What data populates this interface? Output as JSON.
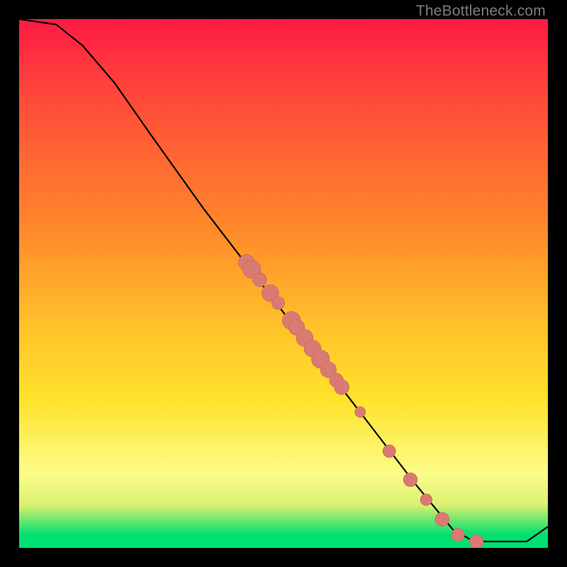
{
  "watermark": "TheBottleneck.com",
  "colors": {
    "red_top": "#ff1a44",
    "orange": "#ff8a2a",
    "yellow": "#ffe22a",
    "pale_yellow": "#fdfd8a",
    "khaki": "#d8f070",
    "green": "#00e070",
    "curve_stroke": "#000000",
    "point_fill": "#d97b72",
    "point_stroke": "#c86a60"
  },
  "chart_data": {
    "type": "line",
    "title": "",
    "xlabel": "",
    "ylabel": "",
    "xlim": [
      0,
      100
    ],
    "ylim": [
      0,
      100
    ],
    "curve": [
      {
        "x": 0,
        "y": 100
      },
      {
        "x": 7,
        "y": 99
      },
      {
        "x": 12,
        "y": 95
      },
      {
        "x": 18,
        "y": 88
      },
      {
        "x": 25,
        "y": 78
      },
      {
        "x": 35,
        "y": 64
      },
      {
        "x": 45,
        "y": 51
      },
      {
        "x": 55,
        "y": 38
      },
      {
        "x": 65,
        "y": 25
      },
      {
        "x": 75,
        "y": 12
      },
      {
        "x": 82,
        "y": 3.5
      },
      {
        "x": 86,
        "y": 1.2
      },
      {
        "x": 92,
        "y": 1.2
      },
      {
        "x": 96,
        "y": 1.2
      },
      {
        "x": 100,
        "y": 4
      }
    ],
    "scatter": [
      {
        "x": 43,
        "y": 54,
        "r": 1.5
      },
      {
        "x": 44,
        "y": 52.7,
        "r": 1.7
      },
      {
        "x": 45.5,
        "y": 50.7,
        "r": 1.3
      },
      {
        "x": 47.5,
        "y": 48.2,
        "r": 1.6
      },
      {
        "x": 49,
        "y": 46.3,
        "r": 1.2
      },
      {
        "x": 51.5,
        "y": 43,
        "r": 1.7
      },
      {
        "x": 52.5,
        "y": 41.7,
        "r": 1.5
      },
      {
        "x": 54,
        "y": 39.7,
        "r": 1.6
      },
      {
        "x": 55.5,
        "y": 37.7,
        "r": 1.6
      },
      {
        "x": 57,
        "y": 35.7,
        "r": 1.7
      },
      {
        "x": 58.5,
        "y": 33.7,
        "r": 1.5
      },
      {
        "x": 60,
        "y": 31.7,
        "r": 1.3
      },
      {
        "x": 61,
        "y": 30.4,
        "r": 1.4
      },
      {
        "x": 64.5,
        "y": 25.7,
        "r": 1.0
      },
      {
        "x": 70,
        "y": 18.3,
        "r": 1.2
      },
      {
        "x": 74,
        "y": 12.9,
        "r": 1.3
      },
      {
        "x": 77,
        "y": 9.1,
        "r": 1.1
      },
      {
        "x": 80,
        "y": 5.4,
        "r": 1.3
      },
      {
        "x": 83,
        "y": 2.5,
        "r": 1.2
      },
      {
        "x": 86.5,
        "y": 1.2,
        "r": 1.3
      }
    ]
  }
}
